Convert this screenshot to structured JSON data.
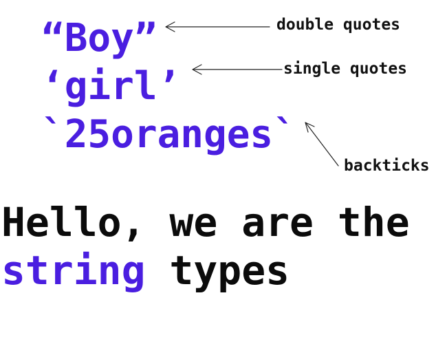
{
  "colors": {
    "accent": "#4a1ee0",
    "text": "#0b0b0b"
  },
  "examples": {
    "double": "“Boy”",
    "single": "‘girl’",
    "backtick": "`25oranges`"
  },
  "labels": {
    "double": "double quotes",
    "single": "single quotes",
    "backtick": "backticks"
  },
  "headline": {
    "line1": "Hello, we are the",
    "highlight": "string",
    "rest": " types"
  }
}
